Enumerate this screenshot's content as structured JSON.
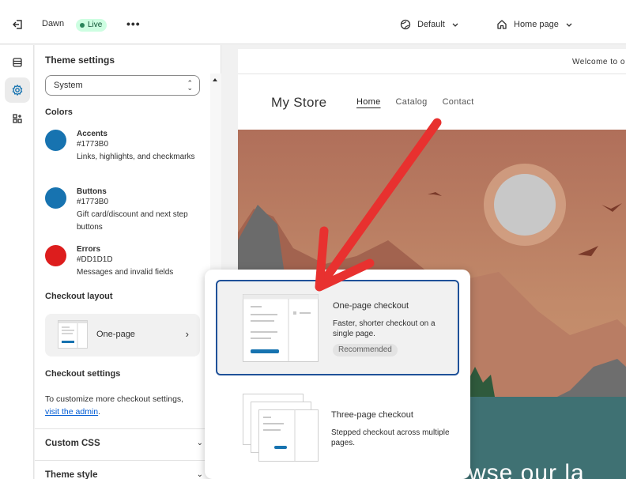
{
  "topbar": {
    "theme_name": "Dawn",
    "status_badge": "Live",
    "more": "•••",
    "template_select": "Default",
    "page_select": "Home page"
  },
  "settings": {
    "title": "Theme settings",
    "color_scheme_select": "System",
    "colors_heading": "Colors",
    "colors": [
      {
        "name": "Accents",
        "hex": "#1773B0",
        "desc": "Links, highlights, and checkmarks"
      },
      {
        "name": "Buttons",
        "hex": "#1773B0",
        "desc": "Gift card/discount and next step buttons"
      },
      {
        "name": "Errors",
        "hex": "#DD1D1D",
        "desc": "Messages and invalid fields"
      }
    ],
    "checkout_layout_heading": "Checkout layout",
    "checkout_layout_value": "One-page",
    "checkout_settings_heading": "Checkout settings",
    "checkout_settings_text": "To customize more checkout settings,",
    "checkout_settings_link": "visit the admin",
    "checkout_settings_period": ".",
    "custom_css": "Custom CSS",
    "theme_style": "Theme style"
  },
  "preview": {
    "announcement": "Welcome to o",
    "store_name": "My Store",
    "nav": [
      "Home",
      "Catalog",
      "Contact"
    ],
    "hero_text": "wse our la"
  },
  "popover": {
    "options": [
      {
        "title": "One-page checkout",
        "desc": "Faster, shorter checkout on a single page.",
        "tag": "Recommended"
      },
      {
        "title": "Three-page checkout",
        "desc": "Stepped checkout across multiple pages."
      }
    ]
  },
  "colors": {
    "accent": "#1773B0",
    "error": "#DD1D1D",
    "selected_border": "#1F5199",
    "annotation_arrow": "#E8312F"
  }
}
